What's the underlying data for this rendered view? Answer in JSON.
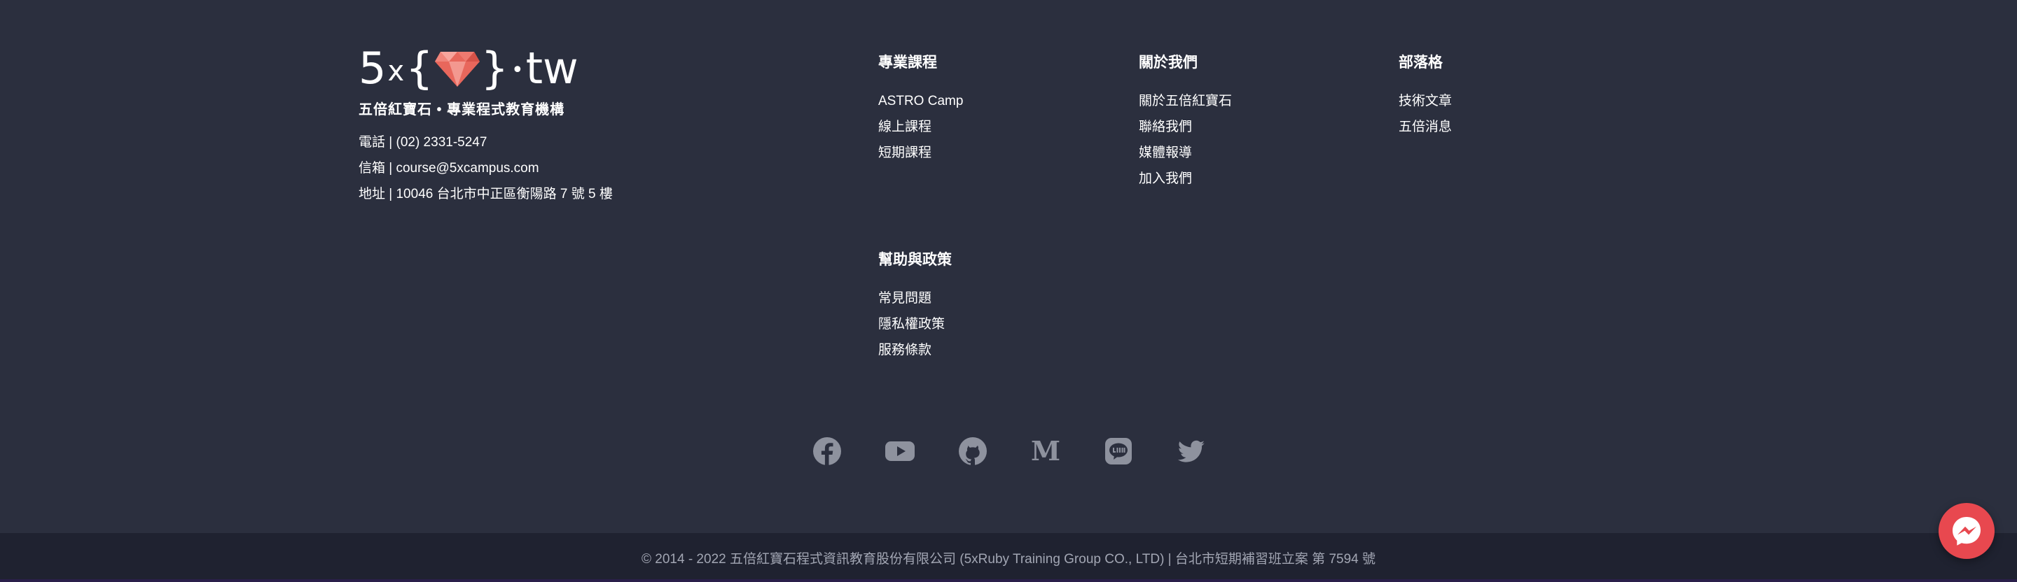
{
  "brand": {
    "logo_prefix": "5",
    "logo_x": "x",
    "logo_brace_open": "{",
    "logo_brace_close": "}",
    "logo_dot": "•",
    "logo_suffix": "tw",
    "tagline": "五倍紅寶石 • 專業程式教育機構",
    "phone": "電話 | (02) 2331-5247",
    "email": "信箱 | course@5xcampus.com",
    "address": "地址 | 10046 台北市中正區衡陽路 7 號 5 樓"
  },
  "columns": {
    "courses": {
      "title": "專業課程",
      "items": [
        "ASTRO Camp",
        "線上課程",
        "短期課程"
      ]
    },
    "about": {
      "title": "關於我們",
      "items": [
        "關於五倍紅寶石",
        "聯絡我們",
        "媒體報導",
        "加入我們"
      ]
    },
    "blog": {
      "title": "部落格",
      "items": [
        "技術文章",
        "五倍消息"
      ]
    },
    "help": {
      "title": "幫助與政策",
      "items": [
        "常見問題",
        "隱私權政策",
        "服務條款"
      ]
    }
  },
  "social": [
    "facebook-icon",
    "youtube-icon",
    "github-icon",
    "medium-icon",
    "line-icon",
    "twitter-icon"
  ],
  "footer": {
    "copyright": "© 2014 - 2022 五倍紅寶石程式資訊教育股份有限公司 (5xRuby Training Group CO., LTD) | 台北市短期補習班立案 第 7594 號"
  },
  "colors": {
    "background": "#2b2f3e",
    "bottom_bar": "#1f2230",
    "icon": "#8e929e",
    "messenger": "#e8484f",
    "ruby": "#e8675c"
  }
}
